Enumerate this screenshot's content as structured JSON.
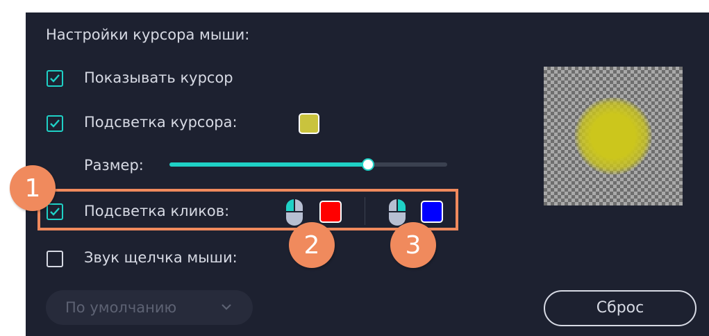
{
  "section_title": "Настройки курсора мыши:",
  "show_cursor": {
    "label": "Показывать курсор",
    "checked": true
  },
  "cursor_highlight": {
    "label": "Подсветка курсора:",
    "checked": true,
    "color": "#c9c33d"
  },
  "size": {
    "label": "Размер:",
    "value_fraction": 0.715
  },
  "click_highlight": {
    "label": "Подсветка кликов:",
    "checked": true,
    "left_click_color": "#ff0000",
    "right_click_color": "#0000ff"
  },
  "click_sound": {
    "label": "Звук щелчка мыши:",
    "checked": false
  },
  "sound_dropdown": {
    "value": "По умолчанию"
  },
  "reset_button": {
    "label": "Сброс"
  },
  "annotations": [
    "1",
    "2",
    "3"
  ],
  "colors": {
    "accent": "#1fd1c6",
    "panel": "#1d2130",
    "annotation": "#f08a5d"
  }
}
